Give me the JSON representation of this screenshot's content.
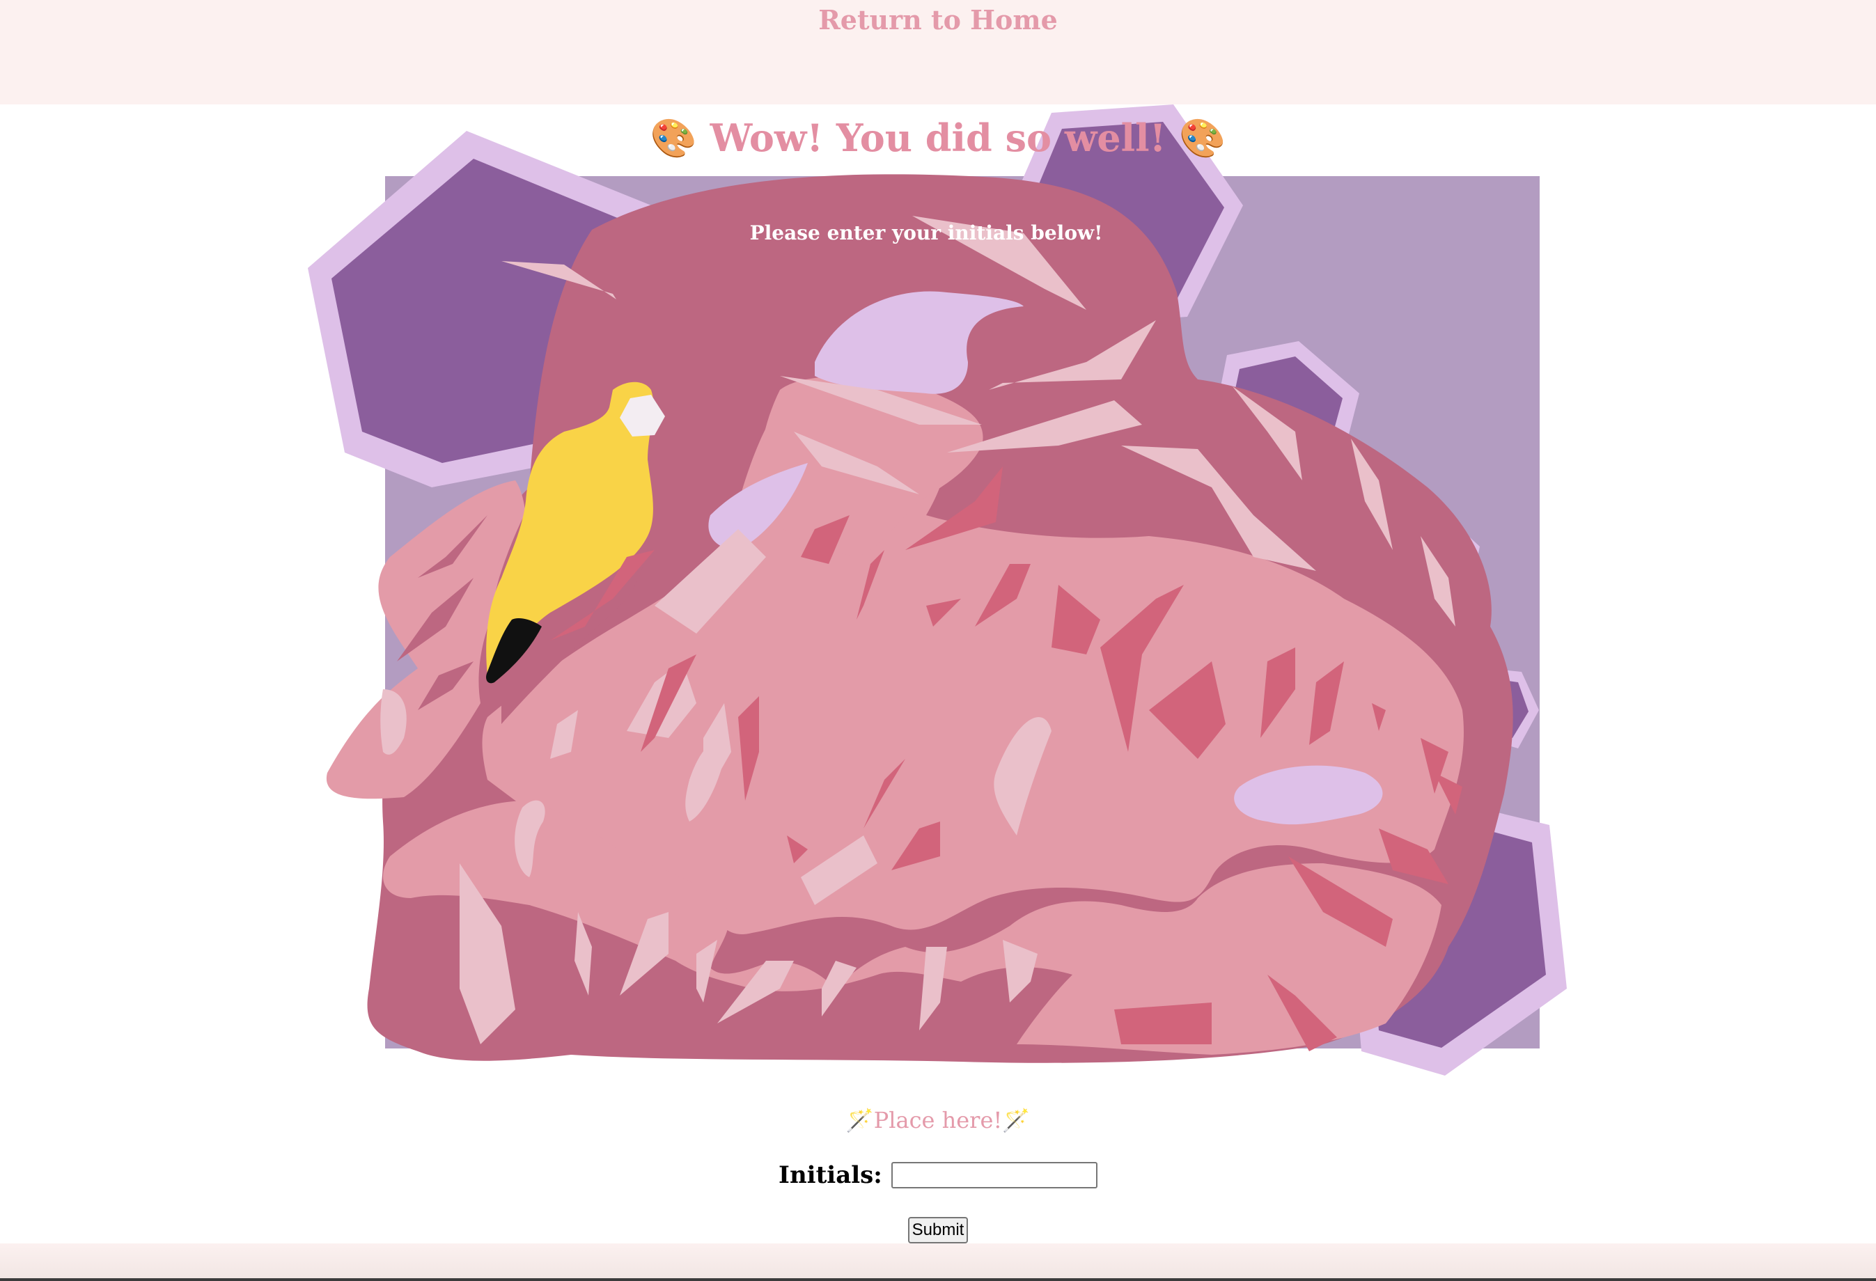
{
  "nav": {
    "home_link": "Return to Home"
  },
  "main": {
    "heading_icon": "🎨",
    "heading_text": "Wow! You did so well!",
    "instructions": "Please enter your initials below!",
    "place_here_icon": "🪄",
    "place_here_text": "Place here!"
  },
  "form": {
    "initials_label": "Initials:",
    "initials_value": "",
    "submit_label": "Submit"
  },
  "artwork": {
    "subject": "flamingo",
    "background_icon": "hexagon-icon"
  },
  "colors": {
    "accent_pink": "#e49aaa",
    "header_bg": "#fcf1f0",
    "lavender_bg": "#b39cc1",
    "hex_dark": "#8b5e9c",
    "hex_light": "#dec0e8",
    "feather_dark": "#bd6781",
    "feather_mid": "#e39ba8",
    "feather_light": "#eac0ca",
    "beak_yellow": "#f9d347"
  }
}
